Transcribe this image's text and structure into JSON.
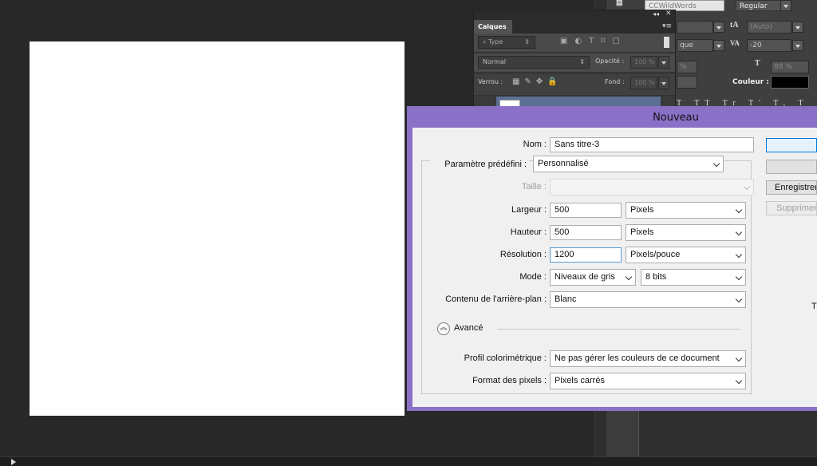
{
  "character_panel": {
    "font_family": "CCWildWords",
    "font_style": "Regular",
    "leading": "(Auto)",
    "kerning_label": "que",
    "tracking": "-20",
    "field_percent_left": "%",
    "scale_value": "88 %",
    "color_label": "Couleur :"
  },
  "layers_panel": {
    "tab_label": "Calques",
    "filter_kind": "Type",
    "blend_mode": "Normal",
    "opacity_label": "Opacité :",
    "opacity_value": "100 %",
    "lock_label": "Verrou :",
    "fill_label": "Fond :",
    "fill_value": "100 %"
  },
  "dialog": {
    "title": "Nouveau",
    "name_label": "Nom :",
    "name_value": "Sans titre-3",
    "preset_label": "Paramètre prédéfini :",
    "preset_value": "Personnalisé",
    "size_label": "Taille :",
    "size_value": "",
    "width_label": "Largeur :",
    "width_value": "500",
    "width_unit": "Pixels",
    "height_label": "Hauteur :",
    "height_value": "500",
    "height_unit": "Pixels",
    "resolution_label": "Résolution :",
    "resolution_value": "1200",
    "resolution_unit": "Pixels/pouce",
    "mode_label": "Mode :",
    "mode_value": "Niveaux de gris",
    "bits_value": "8 bits",
    "background_label": "Contenu de l'arrière-plan :",
    "background_value": "Blanc",
    "advanced_label": "Avancé",
    "profile_label": "Profil colorimétrique :",
    "profile_value": "Ne pas gérer les couleurs de ce document",
    "pixel_aspect_label": "Format des pixels :",
    "pixel_aspect_value": "Pixels carrés",
    "ok_label": "",
    "cancel_label": "",
    "save_preset_label": "Enregistrer",
    "delete_preset_label": "Supprimer",
    "image_size_partial": "T"
  }
}
